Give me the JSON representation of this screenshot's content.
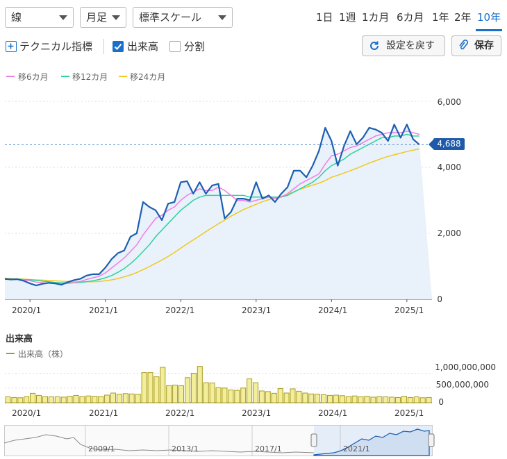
{
  "toolbar": {
    "chart_type": "線",
    "interval": "月足",
    "scale": "標準スケール",
    "periods": [
      "1日",
      "1週",
      "1カ月",
      "6カ月",
      "1年",
      "2年",
      "10年"
    ],
    "active_period": "10年"
  },
  "options": {
    "technical": "テクニカル指標",
    "volume_label": "出来高",
    "volume_checked": true,
    "split_label": "分割",
    "split_checked": false,
    "reset_label": "設定を戻す",
    "save_label": "保存"
  },
  "colors": {
    "price": "#1b5fb0",
    "ma6": "#f07ee6",
    "ma12": "#2ed39a",
    "ma24": "#f2c81e",
    "volume_fill": "#f2ee9a",
    "volume_stroke": "#a89a22",
    "accent": "#1a6fc9"
  },
  "chart_data": [
    {
      "type": "line",
      "x": [
        "2019/09",
        "2019/10",
        "2019/11",
        "2019/12",
        "2020/01",
        "2020/02",
        "2020/03",
        "2020/04",
        "2020/05",
        "2020/06",
        "2020/07",
        "2020/08",
        "2020/09",
        "2020/10",
        "2020/11",
        "2020/12",
        "2021/01",
        "2021/02",
        "2021/03",
        "2021/04",
        "2021/05",
        "2021/06",
        "2021/07",
        "2021/08",
        "2021/09",
        "2021/10",
        "2021/11",
        "2021/12",
        "2022/01",
        "2022/02",
        "2022/03",
        "2022/04",
        "2022/05",
        "2022/06",
        "2022/07",
        "2022/08",
        "2022/09",
        "2022/10",
        "2022/11",
        "2022/12",
        "2023/01",
        "2023/02",
        "2023/03",
        "2023/04",
        "2023/05",
        "2023/06",
        "2023/07",
        "2023/08",
        "2023/09",
        "2023/10",
        "2023/11",
        "2023/12",
        "2024/01",
        "2024/02",
        "2024/03",
        "2024/04",
        "2024/05",
        "2024/06",
        "2024/07",
        "2024/08",
        "2024/09",
        "2024/10",
        "2024/11",
        "2024/12",
        "2025/01",
        "2025/02",
        "2025/03",
        "2025/04",
        "2025/05"
      ],
      "series": [
        {
          "name": "終値",
          "values": [
            620,
            600,
            610,
            560,
            480,
            420,
            470,
            500,
            480,
            440,
            520,
            580,
            620,
            720,
            760,
            760,
            960,
            1220,
            1400,
            1480,
            1900,
            2000,
            2950,
            2800,
            2700,
            2400,
            2900,
            2950,
            3550,
            3580,
            3200,
            3550,
            3200,
            3450,
            3500,
            2450,
            2650,
            3050,
            3050,
            3000,
            3550,
            3050,
            3150,
            2950,
            3200,
            3400,
            3900,
            3900,
            3700,
            4050,
            4500,
            5200,
            4800,
            4050,
            4650,
            5100,
            4700,
            4900,
            5200,
            5150,
            5050,
            4800,
            5300,
            4900,
            5300,
            4850,
            4688
          ]
        },
        {
          "name": "移6カ月",
          "values": [
            610,
            605,
            600,
            590,
            560,
            520,
            500,
            490,
            480,
            470,
            480,
            500,
            540,
            600,
            650,
            700,
            800,
            950,
            1100,
            1250,
            1450,
            1650,
            1950,
            2200,
            2450,
            2550,
            2700,
            2800,
            3000,
            3150,
            3250,
            3350,
            3300,
            3300,
            3400,
            3300,
            3150,
            3000,
            3000,
            2950,
            3000,
            3050,
            3100,
            3050,
            3100,
            3200,
            3350,
            3500,
            3600,
            3700,
            3800,
            4100,
            4350,
            4400,
            4500,
            4600,
            4650,
            4750,
            4850,
            4950,
            5000,
            5050,
            5050,
            5050,
            5100,
            5050,
            5000
          ]
        },
        {
          "name": "移12カ月",
          "values": [
            620,
            615,
            610,
            600,
            590,
            570,
            550,
            530,
            510,
            500,
            500,
            500,
            510,
            530,
            560,
            600,
            650,
            720,
            820,
            930,
            1080,
            1250,
            1450,
            1650,
            1900,
            2100,
            2300,
            2500,
            2700,
            2850,
            3000,
            3100,
            3150,
            3150,
            3150,
            3150,
            3150,
            3150,
            3150,
            3100,
            3100,
            3100,
            3100,
            3100,
            3100,
            3150,
            3250,
            3350,
            3450,
            3550,
            3700,
            3900,
            4050,
            4150,
            4250,
            4400,
            4500,
            4600,
            4700,
            4800,
            4900,
            4900,
            4950,
            4950,
            5000,
            4950,
            4950
          ]
        },
        {
          "name": "移24カ月",
          "values": [
            640,
            630,
            620,
            610,
            600,
            590,
            580,
            570,
            560,
            550,
            540,
            535,
            530,
            530,
            530,
            540,
            560,
            590,
            630,
            680,
            740,
            810,
            900,
            990,
            1090,
            1190,
            1300,
            1420,
            1550,
            1680,
            1800,
            1920,
            2050,
            2170,
            2290,
            2400,
            2520,
            2620,
            2720,
            2800,
            2880,
            2960,
            3020,
            3080,
            3120,
            3180,
            3260,
            3340,
            3400,
            3460,
            3520,
            3600,
            3700,
            3760,
            3830,
            3900,
            3970,
            4050,
            4130,
            4200,
            4270,
            4330,
            4380,
            4430,
            4480,
            4520,
            4560
          ]
        }
      ],
      "ylim": [
        0,
        6000
      ],
      "yticks": [
        0,
        2000,
        4000,
        6000
      ],
      "ytick_labels": [
        "0",
        "2,000",
        "4,000",
        "6,000"
      ],
      "xticks": [
        "2020/1",
        "2021/1",
        "2022/1",
        "2023/1",
        "2024/1",
        "2025/1"
      ],
      "last_value": 4688,
      "last_value_label": "4,688",
      "legend": [
        "移6カ月",
        "移12カ月",
        "移24カ月"
      ],
      "legend_position": "top-left"
    },
    {
      "type": "bar",
      "title": "出来高",
      "legend": [
        "出来高（株）"
      ],
      "x": [
        "2019/09",
        "2019/10",
        "2019/11",
        "2019/12",
        "2020/01",
        "2020/02",
        "2020/03",
        "2020/04",
        "2020/05",
        "2020/06",
        "2020/07",
        "2020/08",
        "2020/09",
        "2020/10",
        "2020/11",
        "2020/12",
        "2021/01",
        "2021/02",
        "2021/03",
        "2021/04",
        "2021/05",
        "2021/06",
        "2021/07",
        "2021/08",
        "2021/09",
        "2021/10",
        "2021/11",
        "2021/12",
        "2022/01",
        "2022/02",
        "2022/03",
        "2022/04",
        "2022/05",
        "2022/06",
        "2022/07",
        "2022/08",
        "2022/09",
        "2022/10",
        "2022/11",
        "2022/12",
        "2023/01",
        "2023/02",
        "2023/03",
        "2023/04",
        "2023/05",
        "2023/06",
        "2023/07",
        "2023/08",
        "2023/09",
        "2023/10",
        "2023/11",
        "2023/12",
        "2024/01",
        "2024/02",
        "2024/03",
        "2024/04",
        "2024/05",
        "2024/06",
        "2024/07",
        "2024/08",
        "2024/09",
        "2024/10",
        "2024/11",
        "2024/12",
        "2025/01",
        "2025/02",
        "2025/03",
        "2025/04",
        "2025/05"
      ],
      "values": [
        200000000,
        180000000,
        170000000,
        210000000,
        320000000,
        250000000,
        210000000,
        200000000,
        200000000,
        190000000,
        220000000,
        250000000,
        210000000,
        230000000,
        220000000,
        210000000,
        260000000,
        330000000,
        290000000,
        310000000,
        300000000,
        290000000,
        1020000000,
        1020000000,
        880000000,
        1200000000,
        580000000,
        600000000,
        580000000,
        850000000,
        1000000000,
        1230000000,
        680000000,
        670000000,
        510000000,
        500000000,
        430000000,
        420000000,
        500000000,
        810000000,
        680000000,
        400000000,
        380000000,
        320000000,
        480000000,
        330000000,
        470000000,
        390000000,
        330000000,
        300000000,
        290000000,
        270000000,
        250000000,
        260000000,
        240000000,
        210000000,
        230000000,
        200000000,
        220000000,
        190000000,
        210000000,
        200000000,
        190000000,
        180000000,
        220000000,
        180000000,
        200000000,
        170000000,
        180000000
      ],
      "ylim": [
        0,
        1200000000
      ],
      "yticks": [
        0,
        500000000,
        1000000000
      ],
      "ytick_labels": [
        "0",
        "500,000,000",
        "1,000,000,000"
      ],
      "xticks": [
        "2020/1",
        "2021/1",
        "2022/1",
        "2023/1",
        "2024/1",
        "2025/1"
      ]
    },
    {
      "type": "area",
      "name": "navigator",
      "xticks": [
        "2009/1",
        "2013/1",
        "2017/1",
        "2021/1"
      ]
    }
  ]
}
